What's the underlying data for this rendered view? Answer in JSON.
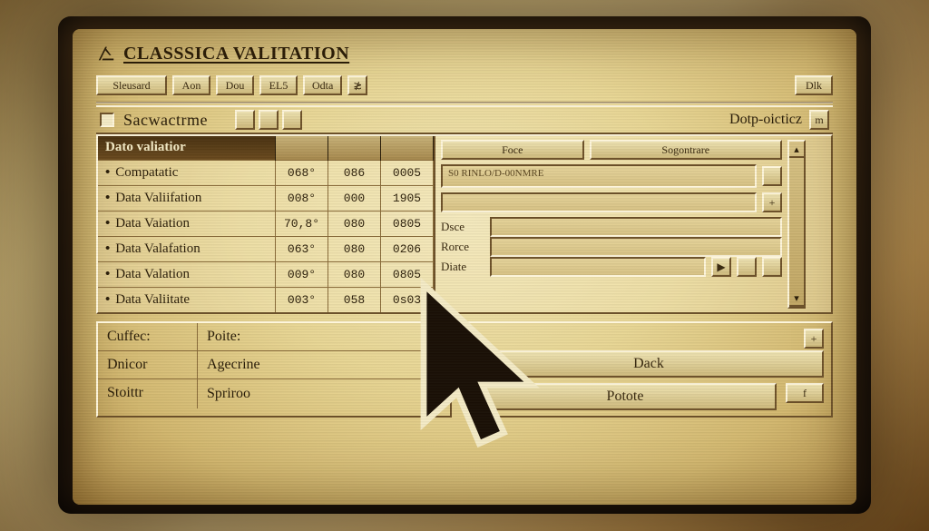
{
  "title": "CLASSSICA VALITATION",
  "title_icon": "classic-logo-icon",
  "menubar": {
    "items": [
      "Sleusard",
      "Aon",
      "Dou",
      "EL5",
      "Odta"
    ],
    "glyph": "≵",
    "right_btn": "Dlk"
  },
  "toolbar2": {
    "label": "Sacwactrme",
    "right_label": "Dotp-oicticz",
    "right_btn": "m"
  },
  "table": {
    "header": "Dato valiatior",
    "rows": [
      {
        "name": "Compatatic",
        "c1": "068°",
        "c2": "086",
        "c3": "0005"
      },
      {
        "name": "Data Valiifation",
        "c1": "008°",
        "c2": "000",
        "c3": "1905"
      },
      {
        "name": "Data Vaiation",
        "c1": "70,8°",
        "c2": "080",
        "c3": "0805"
      },
      {
        "name": "Data Valafation",
        "c1": "063°",
        "c2": "080",
        "c3": "0206"
      },
      {
        "name": "Data Valation",
        "c1": "009°",
        "c2": "080",
        "c3": "0805"
      },
      {
        "name": "Data Valiitate",
        "c1": "003°",
        "c2": "058",
        "c3": "0s03"
      }
    ]
  },
  "form": {
    "top_labels": {
      "left": "Foce",
      "right": "Sogontrare"
    },
    "long_value": "S0 RINLO/D-00NMRE",
    "rows": [
      {
        "label": "Dsce",
        "value": ""
      },
      {
        "label": "Rorce",
        "value": ""
      },
      {
        "label": "Diate",
        "value": ""
      }
    ],
    "play_icon": "▶"
  },
  "kv": [
    {
      "key": "Cuffec:",
      "val": "Poite:"
    },
    {
      "key": "Dnicor",
      "val": "Agecrine"
    },
    {
      "key": "Stoittr",
      "val": "Spriroo"
    }
  ],
  "actions": {
    "plus": "+",
    "primary": "Dack",
    "secondary": "Potote",
    "tail": "f"
  },
  "arrows": {
    "right": "▸",
    "up": "▴",
    "down": "▾"
  }
}
